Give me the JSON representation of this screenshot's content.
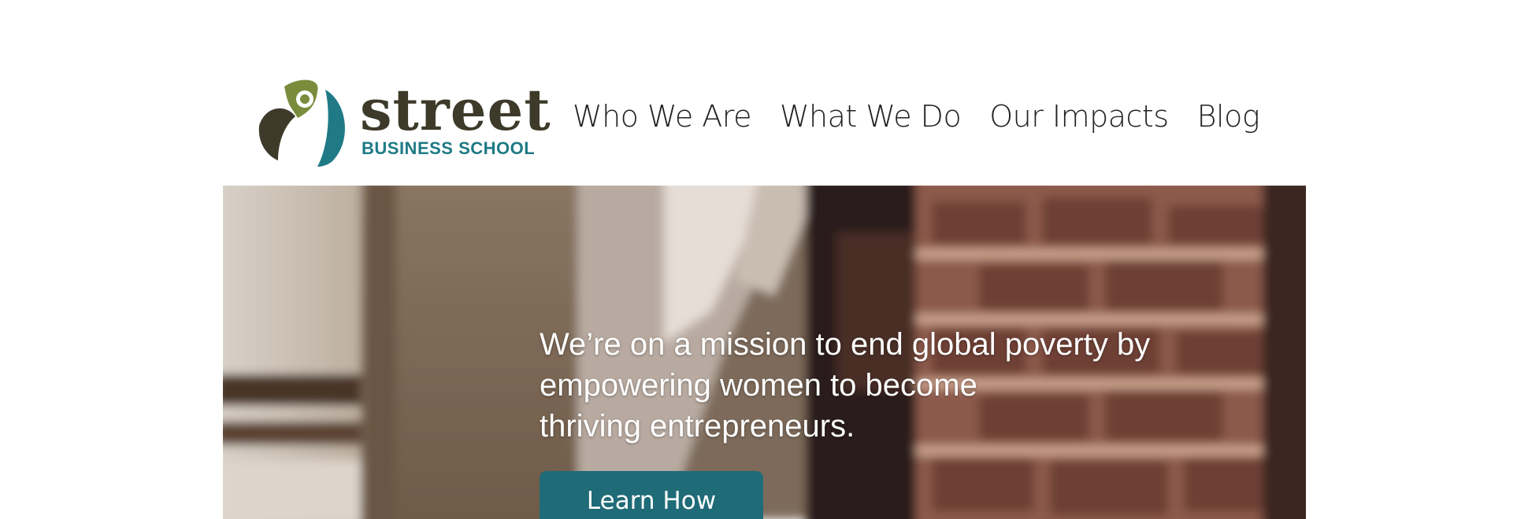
{
  "logo": {
    "wordmark": "street",
    "subtitle": "BUSINESS SCHOOL",
    "colors": {
      "green": "#7a8c3c",
      "teal": "#1f7a85",
      "dark": "#3d3a2a"
    }
  },
  "nav": {
    "items": [
      {
        "label": "Who We Are"
      },
      {
        "label": "What We Do"
      },
      {
        "label": "Our Impacts"
      },
      {
        "label": "Blog"
      }
    ]
  },
  "hero": {
    "lines": [
      "We’re on a mission to end global poverty by",
      "empowering women to become",
      "thriving entrepreneurs."
    ],
    "cta_label": "Learn How",
    "cta_color": "#1f6b77"
  }
}
